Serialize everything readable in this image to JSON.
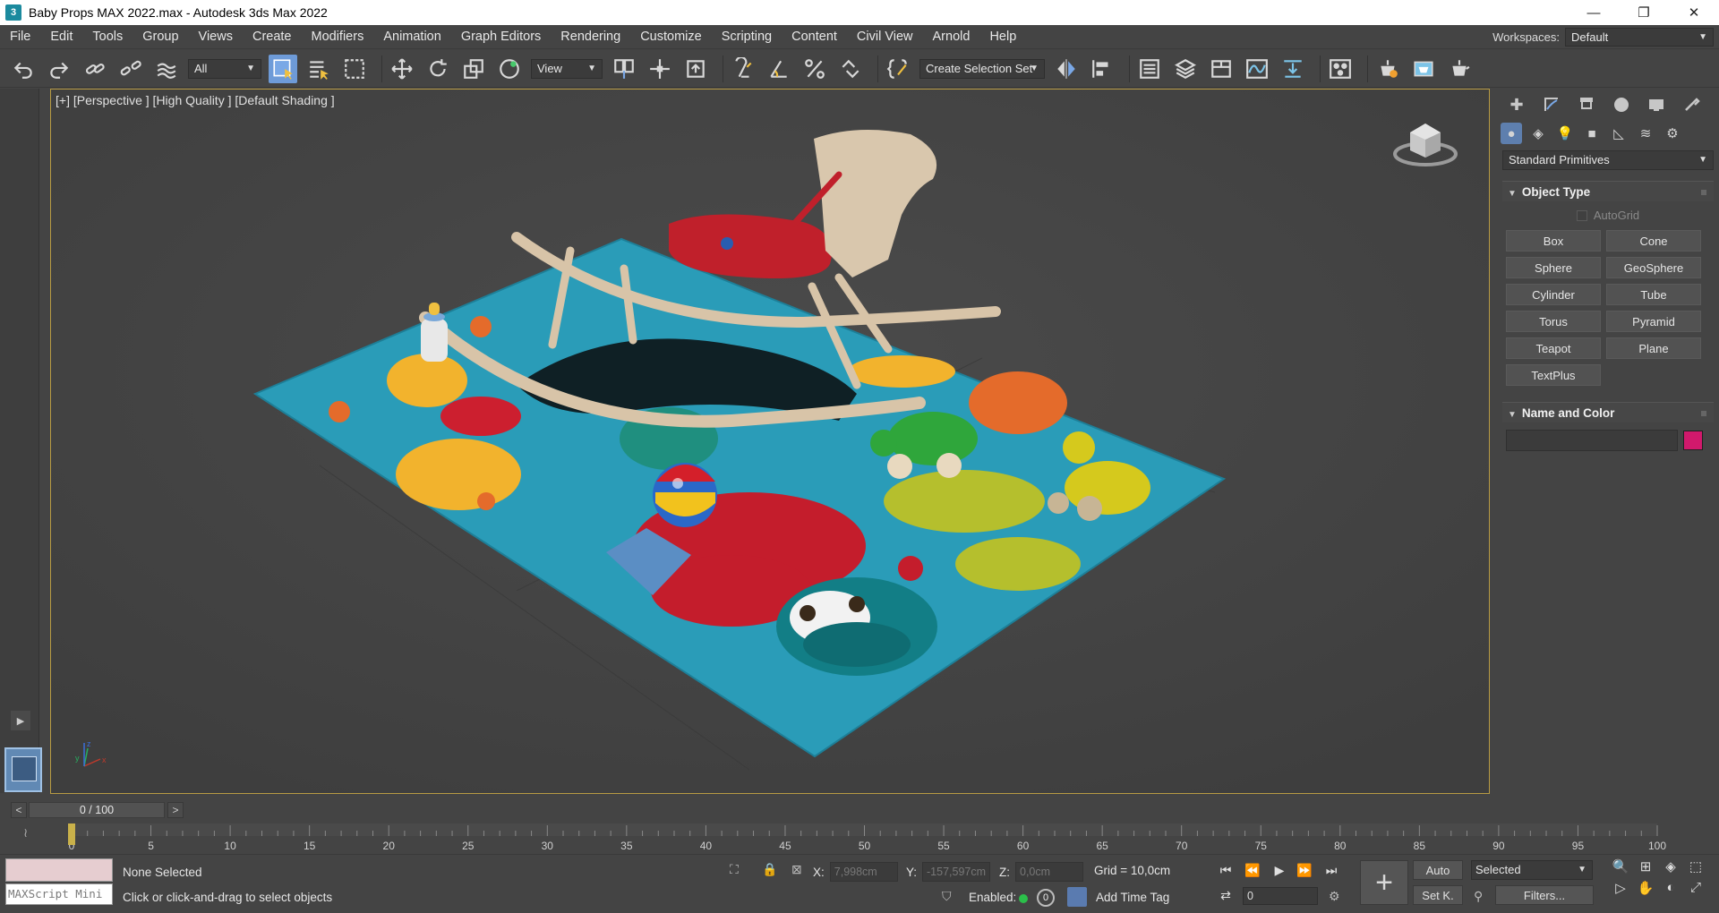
{
  "window": {
    "title": "Baby Props MAX 2022.max - Autodesk 3ds Max 2022",
    "app_icon": "3",
    "minimize": "—",
    "restore": "❐",
    "close": "✕"
  },
  "menu": {
    "items": [
      "File",
      "Edit",
      "Tools",
      "Group",
      "Views",
      "Create",
      "Modifiers",
      "Animation",
      "Graph Editors",
      "Rendering",
      "Customize",
      "Scripting",
      "Content",
      "Civil View",
      "Arnold",
      "Help"
    ],
    "workspaces_label": "Workspaces:",
    "workspace_value": "Default"
  },
  "toolbar": {
    "selection_filter": "All",
    "reference_coord": "View",
    "selection_set": "Create Selection Set"
  },
  "viewport": {
    "label": "[+] [Perspective ] [High Quality ] [Default Shading ]",
    "axis_x": "x",
    "axis_y": "y",
    "axis_z": "z"
  },
  "command_panel": {
    "category": "Standard Primitives",
    "object_type_title": "Object Type",
    "autogrid_label": "AutoGrid",
    "primitives": [
      "Box",
      "Cone",
      "Sphere",
      "GeoSphere",
      "Cylinder",
      "Tube",
      "Torus",
      "Pyramid",
      "Teapot",
      "Plane",
      "TextPlus"
    ],
    "name_color_title": "Name and Color",
    "object_color": "#d1196c"
  },
  "timeline": {
    "frame_display": "0 / 100",
    "prev": "<",
    "next": ">",
    "ticks": [
      "0",
      "5",
      "10",
      "15",
      "20",
      "25",
      "30",
      "35",
      "40",
      "45",
      "50",
      "55",
      "60",
      "65",
      "70",
      "75",
      "80",
      "85",
      "90",
      "95",
      "100"
    ]
  },
  "status": {
    "maxscript_label": "MAXScript Mini",
    "selection_text": "None Selected",
    "prompt_text": "Click or click-and-drag to select objects",
    "x_label": "X:",
    "x_value": "7,998cm",
    "y_label": "Y:",
    "y_value": "-157,597cm",
    "z_label": "Z:",
    "z_value": "0,0cm",
    "grid_text": "Grid = 10,0cm",
    "enabled_label": "Enabled:",
    "time_badge": "0",
    "add_time_tag": "Add Time Tag",
    "auto_label": "Auto",
    "set_key_label": "Set K.",
    "key_filter_value": "Selected",
    "filters_label": "Filters...",
    "current_frame": "0"
  }
}
